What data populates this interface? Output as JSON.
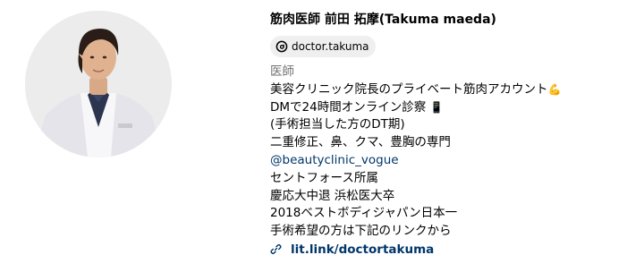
{
  "profile": {
    "display_name_jp": "筋肉医師 前田 拓摩",
    "display_name_romaji": "(Takuma maeda)",
    "threads_handle": "doctor.takuma",
    "bio": {
      "category": "医師",
      "line1": "美容クリニック院長のプライベート筋肉アカウント",
      "line1_emoji": "💪",
      "line2": "DMで24時間オンライン診察",
      "line2_emoji": "📱",
      "line3": "(手術担当した方のDT期)",
      "line4": "二重修正、鼻、クマ、豊胸の専門",
      "mention": "@beautyclinic_vogue",
      "line5": "セントフォース所属",
      "line6": "慶応大中退 浜松医大卒",
      "line7": "2018ベストボディジャパン日本一",
      "line8": "手術希望の方は下記のリンクから"
    },
    "link": "lit.link/doctortakuma"
  },
  "colors": {
    "link": "#00376b",
    "category": "#737373",
    "chip_bg": "#efefef"
  }
}
